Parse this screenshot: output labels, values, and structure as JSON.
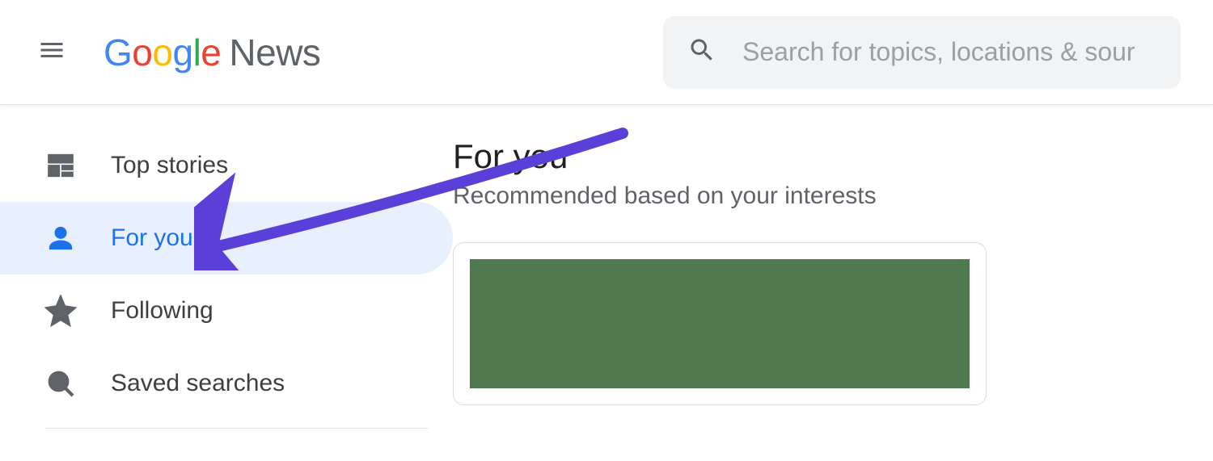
{
  "header": {
    "logo_prefix_letters": [
      "G",
      "o",
      "o",
      "g",
      "l",
      "e"
    ],
    "logo_suffix": "News"
  },
  "search": {
    "placeholder": "Search for topics, locations & sour"
  },
  "sidebar": {
    "items": [
      {
        "icon": "top-stories-icon",
        "label": "Top stories",
        "active": false
      },
      {
        "icon": "person-icon",
        "label": "For you",
        "active": true
      },
      {
        "icon": "star-icon",
        "label": "Following",
        "active": false
      },
      {
        "icon": "search-icon",
        "label": "Saved searches",
        "active": false
      }
    ]
  },
  "main": {
    "title": "For you",
    "subtitle": "Recommended based on your interests"
  },
  "annotation": {
    "arrow_target": "sidebar.items.1"
  }
}
